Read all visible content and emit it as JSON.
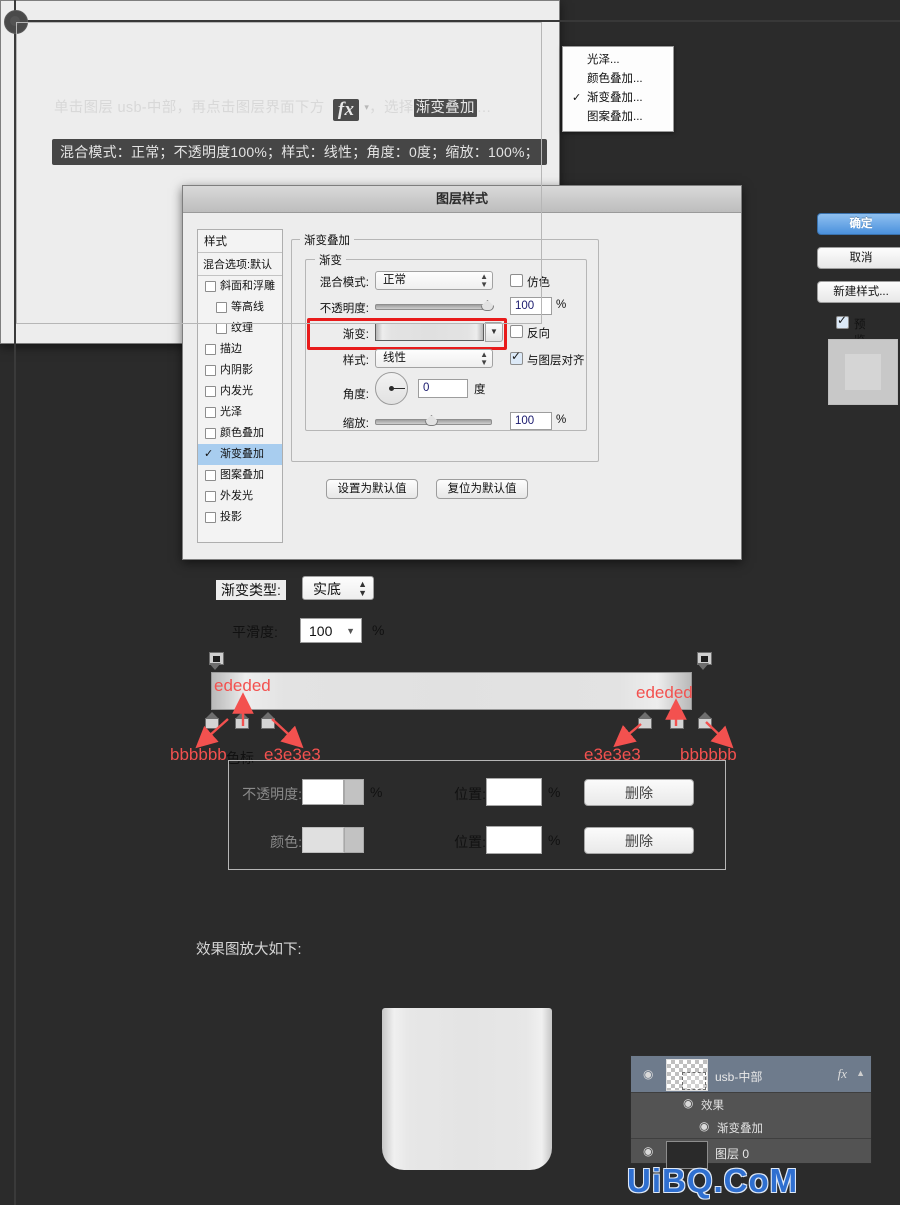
{
  "intro": {
    "part1": "单击图层 usb-中部，再点击图层界面下方",
    "fx_icon": "fx",
    "part2": "，选择",
    "highlight": "渐变叠加",
    "part3": "…",
    "params": "混合模式：正常；不透明度100%；样式：线性；角度：0度；缩放：100%；"
  },
  "fx_menu": {
    "items": [
      {
        "label": "光泽...",
        "checked": false
      },
      {
        "label": "颜色叠加...",
        "checked": false
      },
      {
        "label": "渐变叠加...",
        "checked": true
      },
      {
        "label": "图案叠加...",
        "checked": false
      }
    ],
    "check_glyph": "✓"
  },
  "layer_style": {
    "title": "图层样式",
    "styles_header": "样式",
    "blending_options": "混合选项:默认",
    "items": [
      {
        "label": "斜面和浮雕",
        "indent": false,
        "checked": false,
        "selected": false
      },
      {
        "label": "等高线",
        "indent": true,
        "checked": false,
        "selected": false
      },
      {
        "label": "纹理",
        "indent": true,
        "checked": false,
        "selected": false
      },
      {
        "label": "描边",
        "indent": false,
        "checked": false,
        "selected": false
      },
      {
        "label": "内阴影",
        "indent": false,
        "checked": false,
        "selected": false
      },
      {
        "label": "内发光",
        "indent": false,
        "checked": false,
        "selected": false
      },
      {
        "label": "光泽",
        "indent": false,
        "checked": false,
        "selected": false
      },
      {
        "label": "颜色叠加",
        "indent": false,
        "checked": false,
        "selected": false
      },
      {
        "label": "渐变叠加",
        "indent": false,
        "checked": true,
        "selected": true
      },
      {
        "label": "图案叠加",
        "indent": false,
        "checked": false,
        "selected": false
      },
      {
        "label": "外发光",
        "indent": false,
        "checked": false,
        "selected": false
      },
      {
        "label": "投影",
        "indent": false,
        "checked": false,
        "selected": false
      }
    ],
    "group_outer": "渐变叠加",
    "group_inner": "渐变",
    "blend_mode_label": "混合模式:",
    "blend_mode_value": "正常",
    "dither_label": "仿色",
    "opacity_label": "不透明度:",
    "opacity_value": "100",
    "opacity_pct": "%",
    "gradient_label": "渐变:",
    "reverse_label": "反向",
    "style_label": "样式:",
    "style_value": "线性",
    "align_label": "与图层对齐",
    "angle_label": "角度:",
    "angle_value": "0",
    "angle_unit": "度",
    "scale_label": "缩放:",
    "scale_value": "100",
    "scale_pct": "%",
    "set_default": "设置为默认值",
    "reset_default": "复位为默认值",
    "ok": "确定",
    "cancel": "取消",
    "new_style": "新建样式...",
    "preview": "预览"
  },
  "gradient_editor": {
    "type_label": "渐变类型:",
    "type_value": "实底",
    "smooth_label": "平滑度:",
    "smooth_value": "100",
    "smooth_pct": "%",
    "opacity_label": "不透明度:",
    "opacity_pct": "%",
    "color_label": "颜色:",
    "position_label_1": "位置:",
    "position_label_2": "位置:",
    "position_pct_1": "%",
    "position_pct_2": "%",
    "delete_1": "删除",
    "delete_2": "删除",
    "annotations": {
      "left_outer": "bbbbbb",
      "left_mid": "ededed",
      "left_inner": "e3e3e3",
      "stop_word": "色标",
      "right_inner": "e3e3e3",
      "right_mid": "ededed",
      "right_outer": "bbbbbb"
    },
    "gradient_stops": [
      {
        "position": 0,
        "color": "#bbbbbb"
      },
      {
        "position": 7,
        "color": "#ededed"
      },
      {
        "position": 15,
        "color": "#e3e3e3"
      },
      {
        "position": 85,
        "color": "#e3e3e3"
      },
      {
        "position": 93,
        "color": "#ededed"
      },
      {
        "position": 100,
        "color": "#bbbbbb"
      }
    ]
  },
  "result": {
    "caption": "效果图放大如下:"
  },
  "layers_panel": {
    "rows": [
      {
        "name": "usb-中部",
        "fx": "fx",
        "selected": true
      },
      {
        "name": "效果",
        "selected": false
      },
      {
        "name": "渐变叠加",
        "selected": false
      },
      {
        "name": "图层 0",
        "selected": false
      }
    ],
    "eye_glyph": "◉"
  },
  "watermark": "UiBQ.CoM",
  "accent_color": "#f3514f",
  "highlight_color": "#a8cdef"
}
